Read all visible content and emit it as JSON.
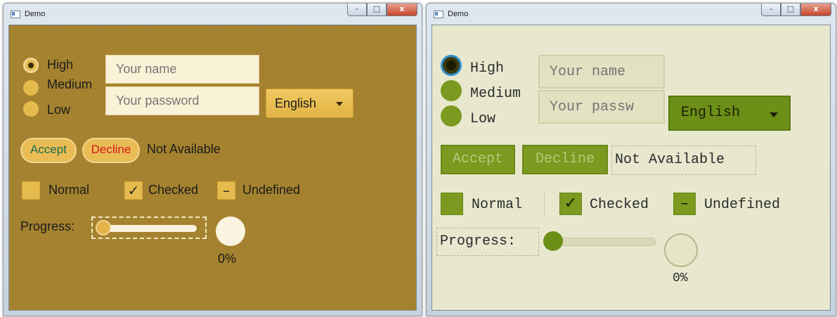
{
  "windows": [
    {
      "title": "Demo",
      "controls": {
        "minimize": "–",
        "maximize": "□",
        "close": "x"
      },
      "radios": [
        {
          "label": "High",
          "selected": true
        },
        {
          "label": "Medium",
          "selected": false
        },
        {
          "label": "Low",
          "selected": false
        }
      ],
      "name_placeholder": "Your name",
      "password_placeholder": "Your password",
      "language": "English",
      "accept_label": "Accept",
      "decline_label": "Decline",
      "status_label": "Not Available",
      "checkboxes": [
        {
          "label": "Normal",
          "mark": ""
        },
        {
          "label": "Checked",
          "mark": "✓"
        },
        {
          "label": "Undefined",
          "mark": "–"
        }
      ],
      "progress_label": "Progress:",
      "slider_value": 0,
      "progress_text": "0%",
      "colors": {
        "background": "#a4822f",
        "accept_text": "#1f6b4e",
        "decline_text": "#d81b1b"
      }
    },
    {
      "title": "Demo",
      "controls": {
        "minimize": "–",
        "maximize": "□",
        "close": "x"
      },
      "radios": [
        {
          "label": "High",
          "selected": true
        },
        {
          "label": "Medium",
          "selected": false
        },
        {
          "label": "Low",
          "selected": false
        }
      ],
      "name_placeholder": "Your name",
      "password_placeholder": "Your passw",
      "language": "English",
      "accept_label": "Accept",
      "decline_label": "Decline",
      "status_label": "Not Available",
      "checkboxes": [
        {
          "label": "Normal",
          "mark": ""
        },
        {
          "label": "Checked",
          "mark": "✓"
        },
        {
          "label": "Undefined",
          "mark": "–"
        }
      ],
      "progress_label": "Progress:",
      "slider_value": 0,
      "progress_text": "0%",
      "colors": {
        "background": "#e8e8cf",
        "accent": "#7b9a1f"
      }
    }
  ]
}
